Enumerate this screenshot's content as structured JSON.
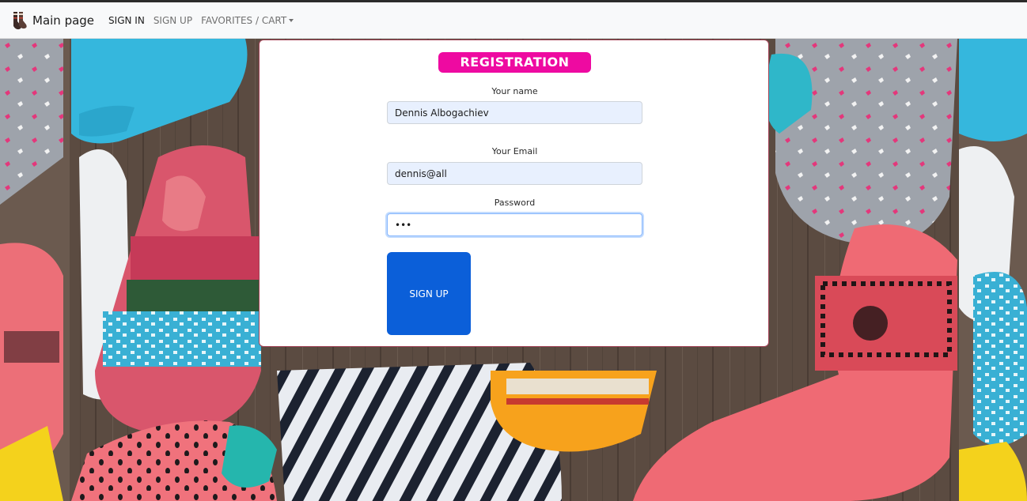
{
  "navbar": {
    "brand_label": "Main page",
    "brand_icon": "socks-logo-icon",
    "links": {
      "sign_in": "SIGN IN",
      "sign_up": "SIGN UP",
      "favorites_cart": "FAVORITES / CART"
    }
  },
  "registration": {
    "title": "REGISTRATION",
    "name_label": "Your name",
    "name_value": "Dennis Albogachiev",
    "email_label": "Your Email",
    "email_value": "dennis@all",
    "password_label": "Password",
    "password_value": "•••",
    "submit_label": "SIGN UP"
  },
  "colors": {
    "title_pill": "#ee0aa1",
    "primary_button": "#0b5fd9",
    "card_border": "#a24256"
  }
}
